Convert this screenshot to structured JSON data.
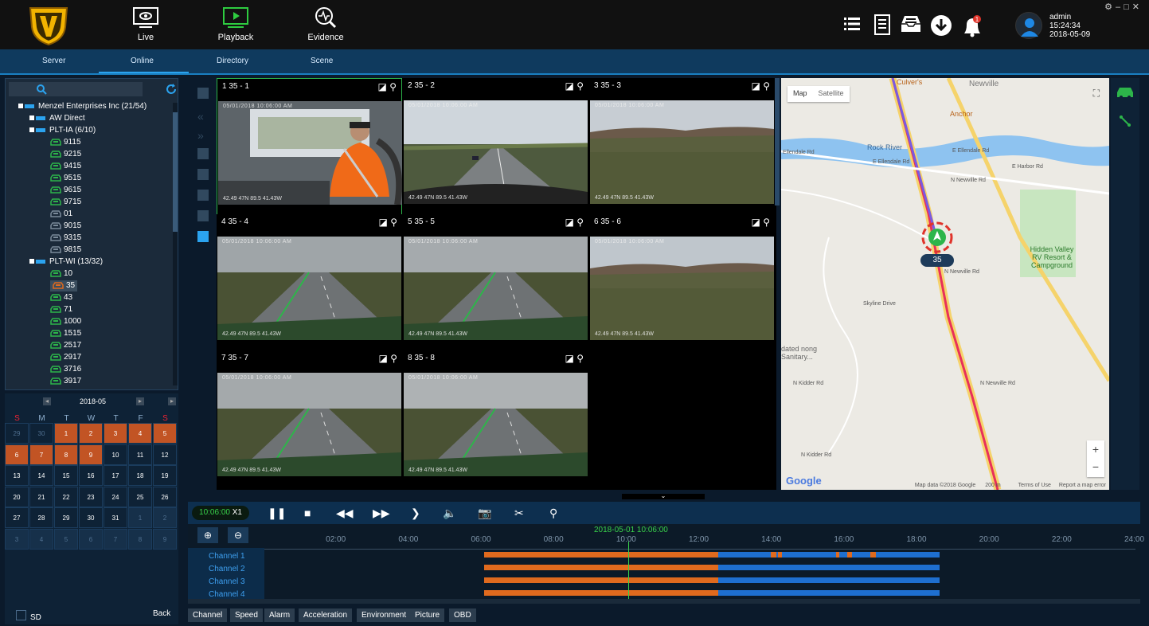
{
  "nav": {
    "live": "Live",
    "playback": "Playback",
    "evidence": "Evidence"
  },
  "user": {
    "name": "admin",
    "time": "15:24:34",
    "date": "2018-05-09",
    "notifications": "1"
  },
  "tabs": [
    "Server",
    "Online",
    "Directory",
    "Scene"
  ],
  "tree": [
    {
      "label": "Menzel Enterprises Inc (21/54)",
      "level": 0,
      "kind": "group"
    },
    {
      "label": "AW Direct",
      "level": 1,
      "kind": "group"
    },
    {
      "label": "PLT-IA (6/10)",
      "level": 1,
      "kind": "group"
    },
    {
      "label": "9115",
      "level": 2,
      "kind": "on"
    },
    {
      "label": "9215",
      "level": 2,
      "kind": "on"
    },
    {
      "label": "9415",
      "level": 2,
      "kind": "on"
    },
    {
      "label": "9515",
      "level": 2,
      "kind": "on"
    },
    {
      "label": "9615",
      "level": 2,
      "kind": "on"
    },
    {
      "label": "9715",
      "level": 2,
      "kind": "on"
    },
    {
      "label": "01",
      "level": 2,
      "kind": "off"
    },
    {
      "label": "9015",
      "level": 2,
      "kind": "off"
    },
    {
      "label": "9315",
      "level": 2,
      "kind": "off"
    },
    {
      "label": "9815",
      "level": 2,
      "kind": "off"
    },
    {
      "label": "PLT-WI (13/32)",
      "level": 1,
      "kind": "group"
    },
    {
      "label": "10",
      "level": 2,
      "kind": "on"
    },
    {
      "label": "35",
      "level": 2,
      "kind": "sel"
    },
    {
      "label": "43",
      "level": 2,
      "kind": "on"
    },
    {
      "label": "71",
      "level": 2,
      "kind": "on"
    },
    {
      "label": "1000",
      "level": 2,
      "kind": "on"
    },
    {
      "label": "1515",
      "level": 2,
      "kind": "on"
    },
    {
      "label": "2517",
      "level": 2,
      "kind": "on"
    },
    {
      "label": "2917",
      "level": 2,
      "kind": "on"
    },
    {
      "label": "3716",
      "level": 2,
      "kind": "on"
    },
    {
      "label": "3917",
      "level": 2,
      "kind": "on"
    }
  ],
  "calendar": {
    "month": "2018-05",
    "dow": [
      "S",
      "M",
      "T",
      "W",
      "T",
      "F",
      "S"
    ],
    "weeks": [
      [
        {
          "d": "29",
          "t": "dim"
        },
        {
          "d": "30",
          "t": "dim"
        },
        {
          "d": "1",
          "t": "rec"
        },
        {
          "d": "2",
          "t": "rec"
        },
        {
          "d": "3",
          "t": "rec"
        },
        {
          "d": "4",
          "t": "rec"
        },
        {
          "d": "5",
          "t": "rec"
        }
      ],
      [
        {
          "d": "6",
          "t": "rec"
        },
        {
          "d": "7",
          "t": "rec"
        },
        {
          "d": "8",
          "t": "rec"
        },
        {
          "d": "9",
          "t": "rec"
        },
        {
          "d": "10",
          "t": ""
        },
        {
          "d": "11",
          "t": ""
        },
        {
          "d": "12",
          "t": ""
        }
      ],
      [
        {
          "d": "13",
          "t": ""
        },
        {
          "d": "14",
          "t": ""
        },
        {
          "d": "15",
          "t": ""
        },
        {
          "d": "16",
          "t": ""
        },
        {
          "d": "17",
          "t": ""
        },
        {
          "d": "18",
          "t": ""
        },
        {
          "d": "19",
          "t": ""
        }
      ],
      [
        {
          "d": "20",
          "t": ""
        },
        {
          "d": "21",
          "t": ""
        },
        {
          "d": "22",
          "t": ""
        },
        {
          "d": "23",
          "t": ""
        },
        {
          "d": "24",
          "t": ""
        },
        {
          "d": "25",
          "t": ""
        },
        {
          "d": "26",
          "t": ""
        }
      ],
      [
        {
          "d": "27",
          "t": ""
        },
        {
          "d": "28",
          "t": ""
        },
        {
          "d": "29",
          "t": ""
        },
        {
          "d": "30",
          "t": ""
        },
        {
          "d": "31",
          "t": ""
        },
        {
          "d": "1",
          "t": "nx"
        },
        {
          "d": "2",
          "t": "nx"
        }
      ],
      [
        {
          "d": "3",
          "t": "nx"
        },
        {
          "d": "4",
          "t": "nx"
        },
        {
          "d": "5",
          "t": "nx"
        },
        {
          "d": "6",
          "t": "nx"
        },
        {
          "d": "7",
          "t": "nx"
        },
        {
          "d": "8",
          "t": "nx"
        },
        {
          "d": "9",
          "t": "nx"
        }
      ]
    ]
  },
  "sd_label": "SD",
  "back_label": "Back",
  "channels": [
    {
      "title": "1 35 - 1",
      "ts": "05/01/2018 10:06:00 AM",
      "gps": "42.49 47N 89.5 41.43W",
      "scene": "cab"
    },
    {
      "title": "2 35 - 2",
      "ts": "05/01/2018 10:06:00 AM",
      "gps": "42.49 47N 89.5 41.43W",
      "scene": "hwy"
    },
    {
      "title": "3 35 - 3",
      "ts": "05/01/2018 10:06:00 AM",
      "gps": "42.49 47N 89.5 41.43W",
      "scene": "field"
    },
    {
      "title": "4 35 - 4",
      "ts": "05/01/2018 10:06:00 AM",
      "gps": "42.49 47N 89.5 41.43W",
      "scene": "road"
    },
    {
      "title": "5 35 - 5",
      "ts": "05/01/2018 10:06:00 AM",
      "gps": "42.49 47N 89.5 41.43W",
      "scene": "road2"
    },
    {
      "title": "6 35 - 6",
      "ts": "05/01/2018 10:06:00 AM",
      "gps": "42.49 47N 89.5 41.43W",
      "scene": "field2"
    },
    {
      "title": "7 35 - 7",
      "ts": "05/01/2018 10:06:00 AM",
      "gps": "42.49 47N 89.5 41.43W",
      "scene": "road3"
    },
    {
      "title": "8 35 - 8",
      "ts": "05/01/2018 10:06:00 AM",
      "gps": "42.49 47N 89.5 41.43W",
      "scene": "road4"
    }
  ],
  "map": {
    "map_btn": "Map",
    "satellite_btn": "Satellite",
    "labels": [
      "Newville",
      "Anchor",
      "Rock River",
      "E Ellendale Rd",
      "E Ellendale Rd",
      "Ellendale Rd",
      "E Harbor Rd",
      "N Newville Rd",
      "N Newville Rd",
      "N Newville Rd",
      "Skyline Drive",
      "N Kidder Rd",
      "N Kidder Rd",
      "Hidden Valley RV Resort & Campground",
      "dated nong Sanitary...",
      "Culver's"
    ],
    "vehicle_label": "35",
    "attribution": "Map data ©2018 Google",
    "scale": "200 m",
    "terms": "Terms of Use",
    "report": "Report a map error",
    "google": "Google"
  },
  "playback": {
    "time": "10:06:00",
    "speed": "X1",
    "current": "2018-05-01 10:06:00",
    "hours": [
      "02:00",
      "04:00",
      "06:00",
      "08:00",
      "10:00",
      "12:00",
      "14:00",
      "16:00",
      "18:00",
      "20:00",
      "22:00",
      "24:00"
    ],
    "channels": [
      "Channel 1",
      "Channel 2",
      "Channel 3",
      "Channel 4"
    ],
    "colors": {
      "normal": "#e06a1e",
      "alarm": "#1e6fd0"
    }
  },
  "bottom_tabs": [
    "Channel",
    "Speed",
    "Alarm",
    "Acceleration",
    "Environment",
    "Picture",
    "OBD"
  ]
}
